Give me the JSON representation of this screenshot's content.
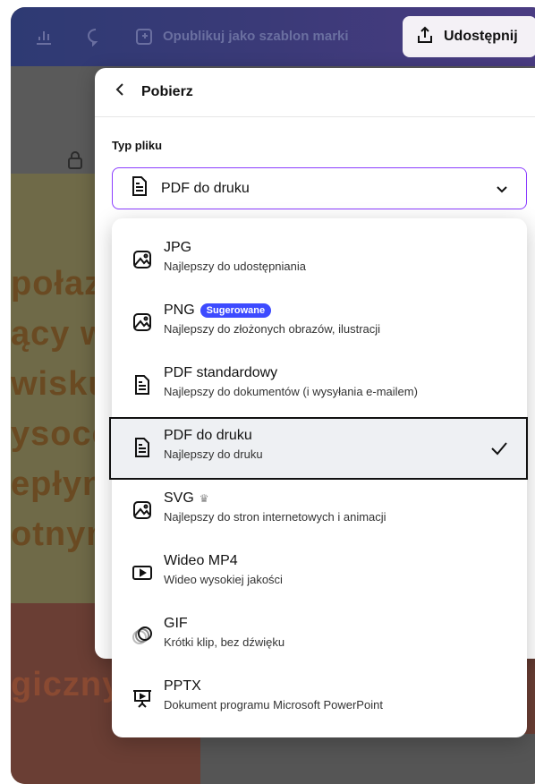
{
  "topbar": {
    "publish_label": "Opublikuj jako szablon marki",
    "share_label": "Udostępnij"
  },
  "background_text": [
    "połaza",
    "ący w",
    "wisku",
    "ysocę",
    "epłyn",
    "otnym",
    "giczny"
  ],
  "panel": {
    "title": "Pobierz",
    "file_type_label": "Typ pliku",
    "selected_value": "PDF do druku"
  },
  "options": [
    {
      "name": "JPG",
      "desc": "Najlepszy do udostępniania",
      "icon": "image-icon"
    },
    {
      "name": "PNG",
      "badge": "Sugerowane",
      "desc": "Najlepszy do złożonych obrazów, ilustracji",
      "icon": "image-icon"
    },
    {
      "name": "PDF standardowy",
      "desc": "Najlepszy do dokumentów (i wysyłania e-mailem)",
      "icon": "document-icon"
    },
    {
      "name": "PDF do druku",
      "desc": "Najlepszy do druku",
      "icon": "document-icon",
      "selected": true
    },
    {
      "name": "SVG",
      "premium": "♛",
      "desc": "Najlepszy do stron internetowych i animacji",
      "icon": "image-icon"
    },
    {
      "name": "Wideo MP4",
      "desc": "Wideo wysokiej jakości",
      "icon": "video-icon"
    },
    {
      "name": "GIF",
      "desc": "Krótki klip, bez dźwięku",
      "icon": "gif-icon"
    },
    {
      "name": "PPTX",
      "desc": "Dokument programu Microsoft PowerPoint",
      "icon": "presentation-icon"
    }
  ]
}
